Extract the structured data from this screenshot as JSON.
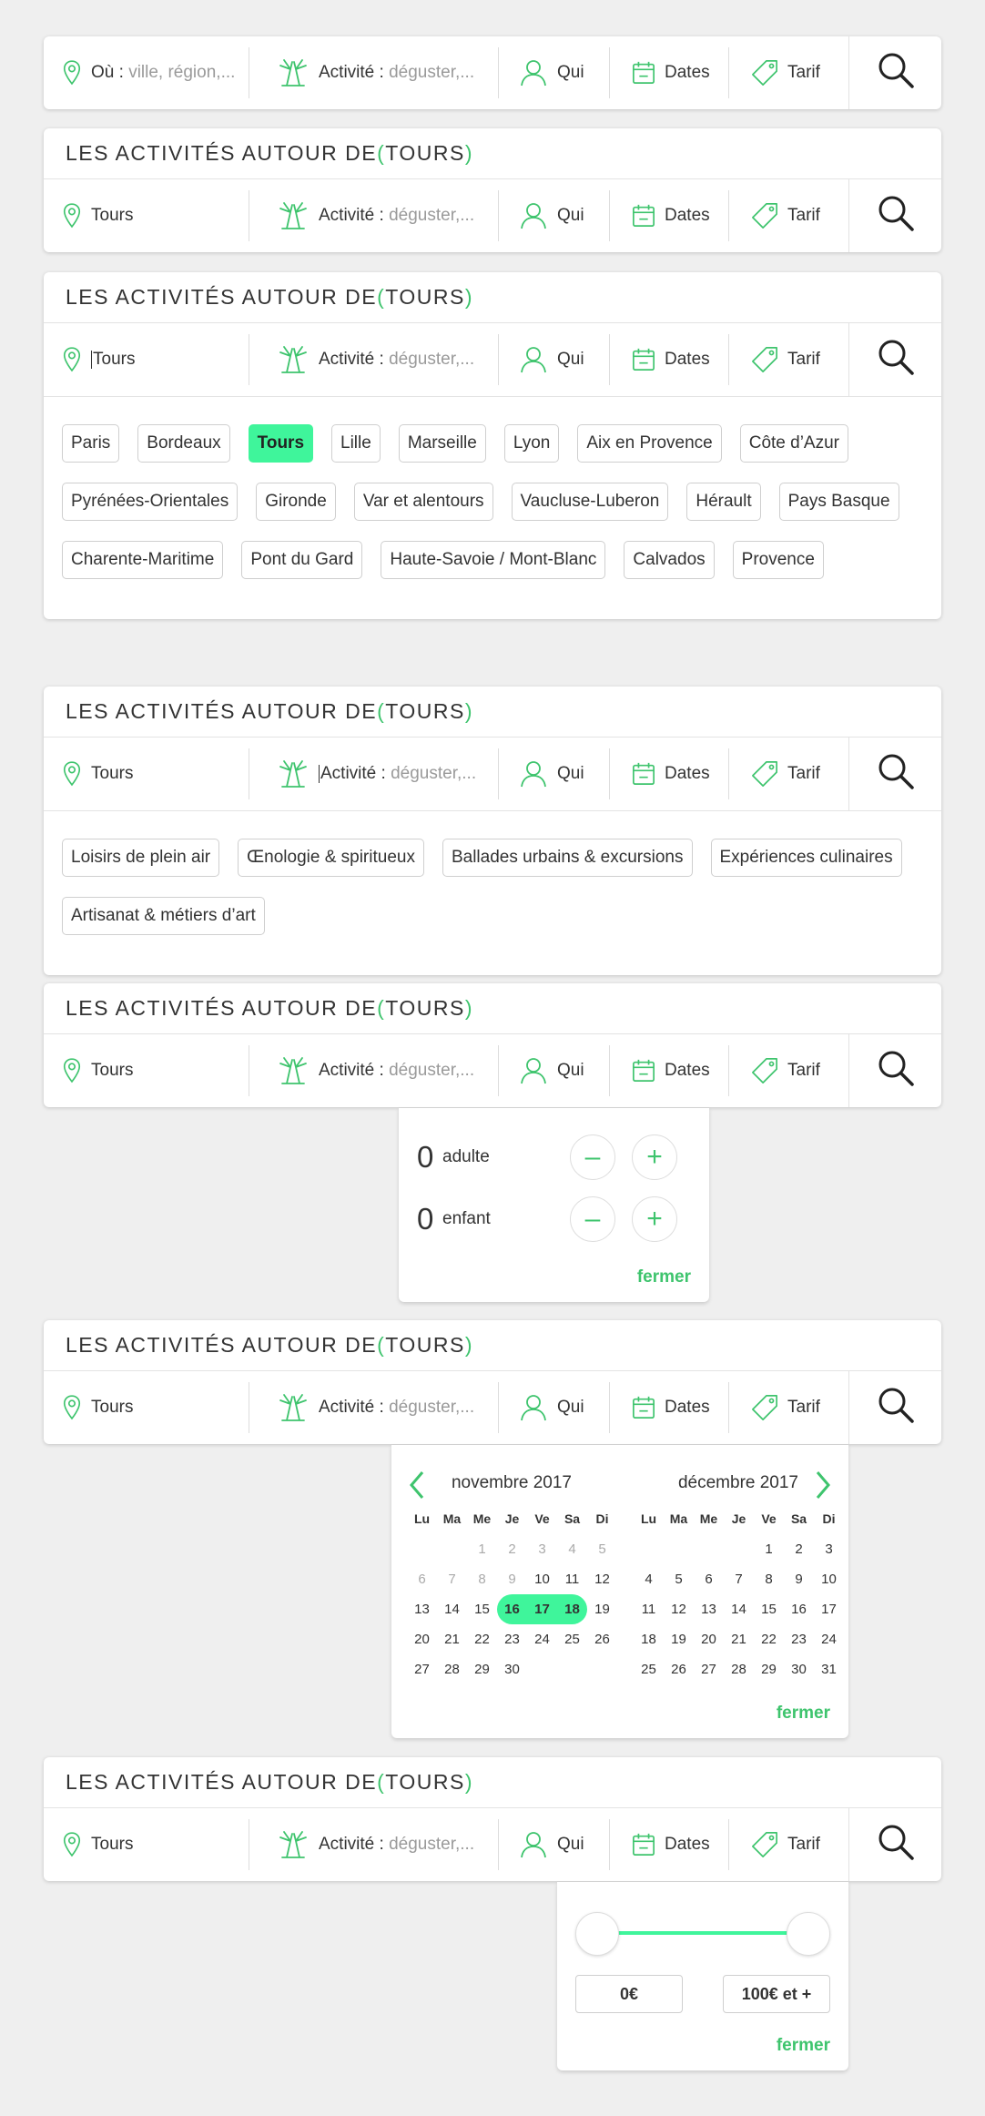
{
  "colors": {
    "accent": "#3ec46d",
    "highlight": "#3ff59b",
    "bg": "#efefef"
  },
  "title": {
    "prefix": "LES ACTIVITÉS AUTOUR DE ",
    "open": "(",
    "city": "TOURS",
    "close": ")"
  },
  "search": {
    "where_label": "Où :",
    "where_placeholder": "ville, région,...",
    "where_value": "Tours",
    "activity_label": "Activité :",
    "activity_placeholder": "déguster,...",
    "who": "Qui",
    "dates": "Dates",
    "tarif": "Tarif"
  },
  "icons": [
    "location-pin-icon",
    "palm-trees-icon",
    "person-icon",
    "calendar-icon",
    "price-tag-icon",
    "magnifier-icon"
  ],
  "destinations": [
    "Paris",
    "Bordeaux",
    "Tours",
    "Lille",
    "Marseille",
    "Lyon",
    "Aix en Provence",
    "Côte d’Azur",
    "Pyrénées-Orientales",
    "Gironde",
    "Var et alentours",
    "Vaucluse-Luberon",
    "Hérault",
    "Pays Basque",
    "Charente-Maritime",
    "Pont du Gard",
    "Haute-Savoie / Mont-Blanc",
    "Calvados",
    "Provence"
  ],
  "selected_destination": "Tours",
  "activities": [
    "Loisirs de plein air",
    "Œnologie & spiritueux",
    "Ballades urbains & excursions",
    "Expériences culinaires",
    "Artisanat & métiers d’art"
  ],
  "guests": {
    "adults_count": "0",
    "adults_label": "adulte",
    "children_count": "0",
    "children_label": "enfant",
    "minus": "–",
    "plus": "+"
  },
  "close_label": "fermer",
  "calendar": {
    "weekdays": [
      "Lu",
      "Ma",
      "Me",
      "Je",
      "Ve",
      "Sa",
      "Di"
    ],
    "months": [
      {
        "name": "novembre 2017",
        "offset": 2,
        "days": 30,
        "past_until": 9,
        "selected": [
          16,
          17,
          18
        ]
      },
      {
        "name": "décembre 2017",
        "offset": 4,
        "days": 31,
        "past_until": 0,
        "selected": []
      }
    ]
  },
  "price": {
    "min_label": "0€",
    "max_label": "100€ et +",
    "min_fraction": 0,
    "max_fraction": 1
  }
}
